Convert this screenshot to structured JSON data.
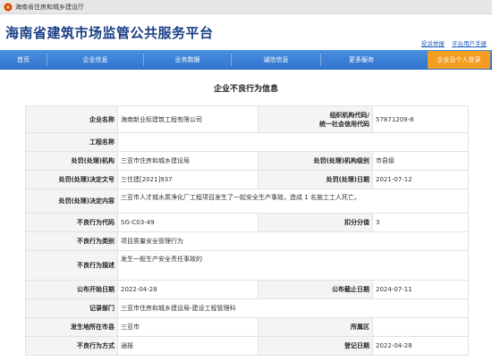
{
  "topbar": {
    "department": "海南省住房和城乡建设厅"
  },
  "header": {
    "title": "海南省建筑市场监管公共服务平台",
    "links": [
      "投诉举报",
      "平台用户手册"
    ]
  },
  "nav": {
    "items": [
      "首页",
      "企业信息",
      "业务数据",
      "诚信信息",
      "更多服务"
    ],
    "portal": "企业及个人登录",
    "colors": {
      "nav": "#3a80d6",
      "portal": "#f39c1f",
      "title": "#1b3f86"
    }
  },
  "section": {
    "title": "企业不良行为信息"
  },
  "record": {
    "company_label": "企业名称",
    "company": "海南新业标建筑工程有限公司",
    "org_code_label_1": "组织机构代码/",
    "org_code_label_2": "统一社会信用代码",
    "org_code": "57871209-8",
    "project_label": "工程名称",
    "project": "",
    "penalty_org_label": "处罚(处理)机构",
    "penalty_org": "三亚市住房和城乡建设局",
    "penalty_level_label": "处罚(处理)机构级别",
    "penalty_level": "市县级",
    "decision_no_label": "处罚(处理)决定文号",
    "decision_no": "三住建[2021]937",
    "decision_date_label": "处罚(处理)日期",
    "decision_date": "2021-07-12",
    "decision_content_label": "处罚(处理)决定内容",
    "decision_content": "三亚市人才城水质净化厂工程项目发生了一起安全生产事故，造成 1 名施工工人死亡。",
    "behavior_code_label": "不良行为代码",
    "behavior_code": "SG-C03-49",
    "score_label": "扣分分值",
    "score": "3",
    "behavior_type_label": "不良行为类别",
    "behavior_type": "项目质量安全管理行为",
    "behavior_desc_label": "不良行为描述",
    "behavior_desc": "发生一般生产安全责任事故的",
    "publish_start_label": "公布开始日期",
    "publish_start": "2022-04-28",
    "publish_end_label": "公布截止日期",
    "publish_end": "2024-07-11",
    "record_dept_label": "记录部门",
    "record_dept": "三亚市住房和城乡建设局-建设工程管理科",
    "location_label": "发生地所在市县",
    "location": "三亚市",
    "district_label": "所属区",
    "district": "",
    "behavior_form_label": "不良行为方式",
    "behavior_form": "通报",
    "register_date_label": "登记日期",
    "register_date": "2022-04-28"
  }
}
